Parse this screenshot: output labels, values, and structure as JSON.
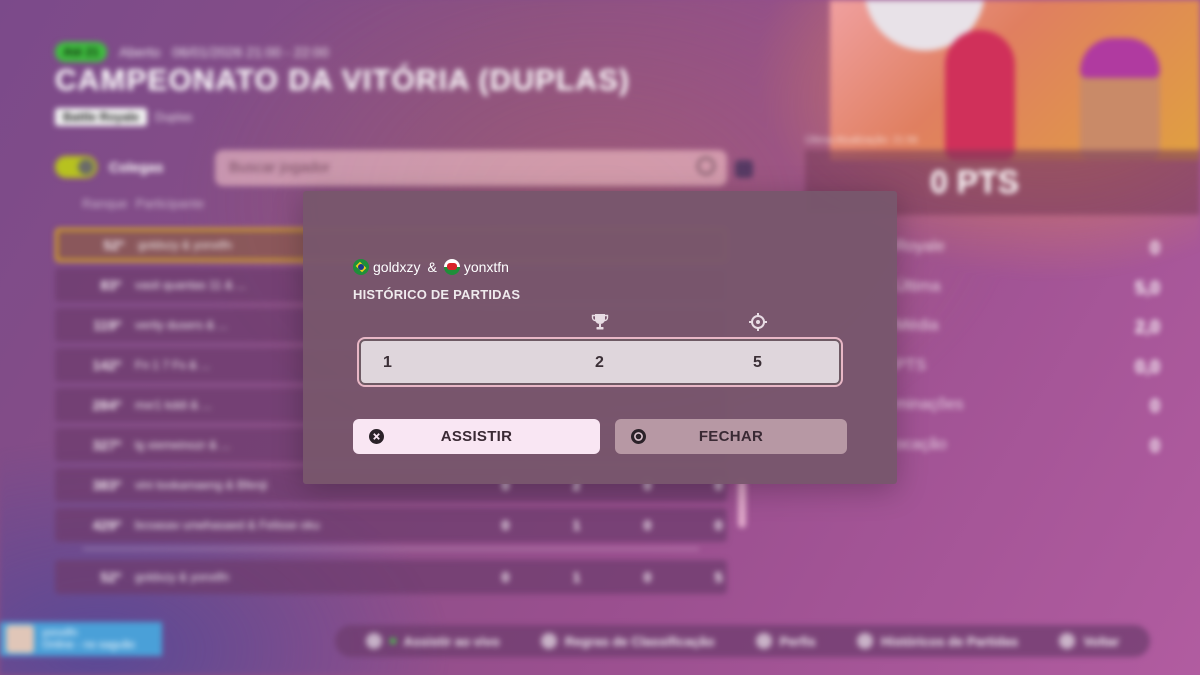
{
  "background": {
    "badge": "Até 21",
    "status": "Aberto",
    "datetime": "06/01/2026 21:00 - 22:00",
    "title": "CAMPEONATO DA VITÓRIA (DUPLAS)",
    "mode_pill": "Battle Royale",
    "mode_sub": "Duplas",
    "toggle_label": "Colegas",
    "search_placeholder": "Buscar jogador",
    "col_rank": "Ranque",
    "col_participants": "Participante",
    "rows": [
      {
        "rank": "52º",
        "names": "goldxzy & yonxtfn",
        "nums": [
          "",
          "",
          "",
          ""
        ]
      },
      {
        "rank": "83º",
        "names": "vasit quantas 11 & ...",
        "nums": [
          "",
          "",
          "",
          ""
        ]
      },
      {
        "rank": "119º",
        "names": "verity dusers & ...",
        "nums": [
          "",
          "",
          "",
          ""
        ]
      },
      {
        "rank": "142º",
        "names": "Fn 1 7 Fs & ...",
        "nums": [
          "",
          "",
          "",
          ""
        ]
      },
      {
        "rank": "284º",
        "names": "mxr1 kddi & ...",
        "nums": [
          "",
          "",
          "",
          ""
        ]
      },
      {
        "rank": "327º",
        "names": "lg xiemeinozr & ...",
        "nums": [
          "",
          "",
          "",
          ""
        ]
      },
      {
        "rank": "383º",
        "names": "vini tookamaeng & Bfenji",
        "nums": [
          "0",
          "2",
          "0",
          "0"
        ]
      },
      {
        "rank": "429º",
        "names": "bcoasav unwhasaed & Felisse oku",
        "nums": [
          "0",
          "1",
          "0",
          "0"
        ]
      }
    ],
    "me_row": {
      "rank": "52º",
      "names": "goldxzy & yonxtfn",
      "nums": [
        "0",
        "1",
        "0",
        "5"
      ]
    },
    "pts_label": "Última Atualização: 21:56",
    "pts_value": "0 PTS",
    "stats": [
      {
        "k": "Royale",
        "v": "0"
      },
      {
        "k": "Última",
        "v": "5,0"
      },
      {
        "k": "Média",
        "v": "2,0"
      },
      {
        "k": "PTS",
        "v": "0,0"
      },
      {
        "k": "minações",
        "v": "0"
      },
      {
        "k": "ocação",
        "v": "0"
      }
    ],
    "player_name": "yonxtfn",
    "player_sub": "Online - no saguão",
    "bottom_bar": [
      "Assistir ao vivo",
      "Regras de Classificação",
      "Perfis",
      "Históricos de Partidas",
      "Voltar"
    ]
  },
  "modal": {
    "player1": "goldxzy",
    "amp": "&",
    "player2": "yonxtfn",
    "history_title": "HISTÓRICO DE PARTIDAS",
    "match": {
      "match": "1",
      "placement": "2",
      "eliminations": "5"
    },
    "watch_label": "ASSISTIR",
    "close_label": "FECHAR"
  },
  "icons": {
    "col2": "trophy-icon",
    "col3": "crosshair-icon",
    "watch": "cross-button-icon",
    "close": "circle-button-icon"
  },
  "colors": {
    "modal_bg": "#78566c",
    "row_bg": "#dfd6dc",
    "watch_btn": "#f9e6f3",
    "close_btn": "#b798a4",
    "rank_highlight": "#d8a624"
  }
}
